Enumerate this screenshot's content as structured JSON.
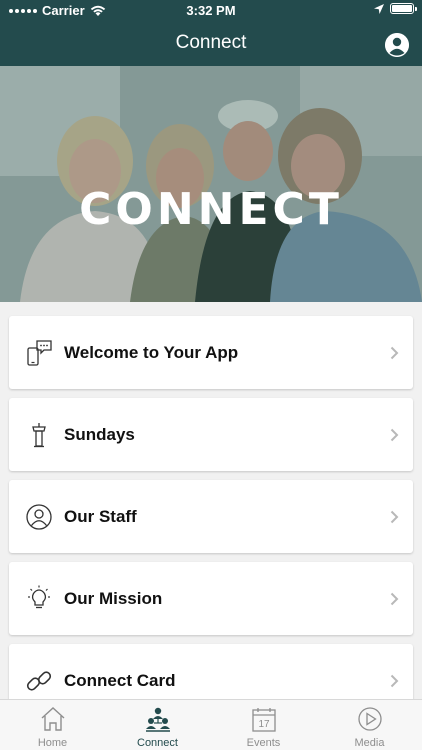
{
  "status_bar": {
    "carrier": "Carrier",
    "time": "3:32 PM"
  },
  "nav": {
    "title": "Connect",
    "profile_icon": "person-circle-icon"
  },
  "hero": {
    "title": "CONNECT"
  },
  "list_items": [
    {
      "label": "Welcome to Your App",
      "icon": "phone-chat-icon"
    },
    {
      "label": "Sundays",
      "icon": "podium-icon"
    },
    {
      "label": "Our Staff",
      "icon": "person-circle-icon"
    },
    {
      "label": "Our Mission",
      "icon": "lightbulb-icon"
    },
    {
      "label": "Connect Card",
      "icon": "link-icon"
    }
  ],
  "tabs": [
    {
      "label": "Home",
      "icon": "house-icon",
      "active": false
    },
    {
      "label": "Connect",
      "icon": "group-icon",
      "active": true
    },
    {
      "label": "Events",
      "icon": "calendar-icon",
      "calendar_day": "17",
      "active": false
    },
    {
      "label": "Media",
      "icon": "play-circle-icon",
      "active": false
    }
  ],
  "colors": {
    "brand": "#234b4d",
    "tab_inactive": "#8e8e8e",
    "chevron": "#b8b8b8"
  }
}
